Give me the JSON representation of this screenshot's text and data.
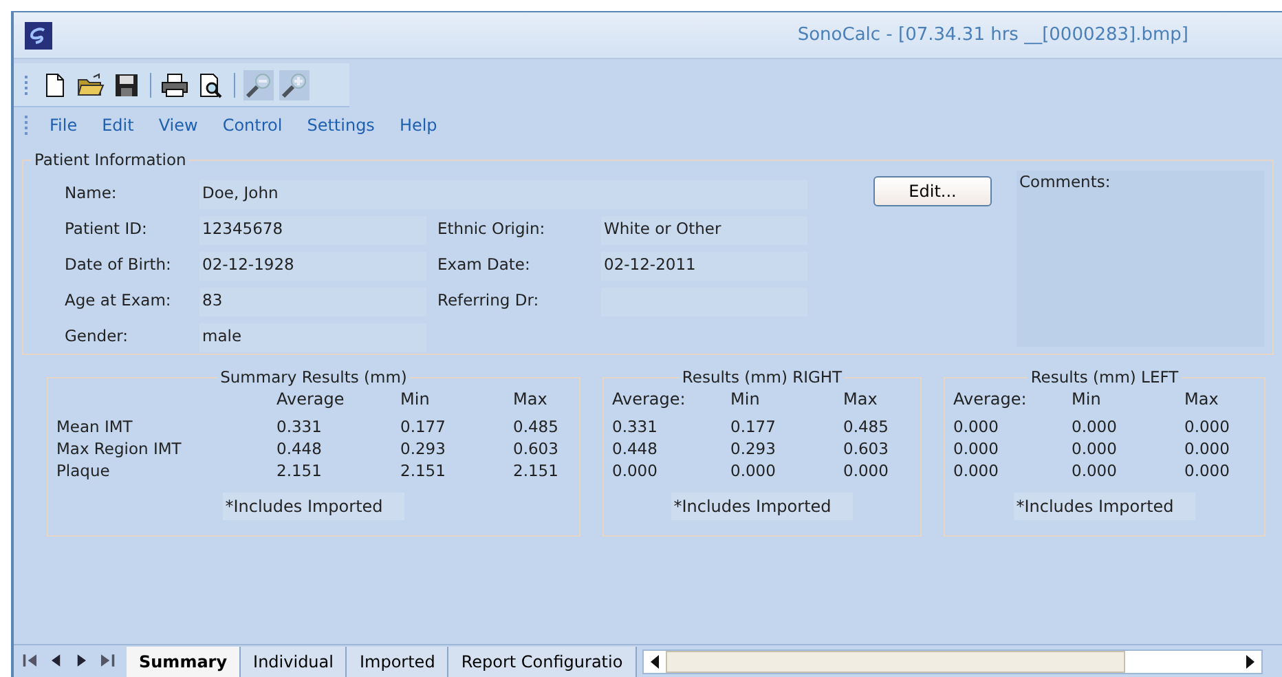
{
  "window": {
    "title": "SonoCalc - [07.34.31 hrs __[0000283].bmp]"
  },
  "toolbar": [
    {
      "kind": "new",
      "disabled": false
    },
    {
      "kind": "open",
      "disabled": false
    },
    {
      "kind": "save",
      "disabled": false
    },
    {
      "kind": "separator"
    },
    {
      "kind": "print",
      "disabled": false
    },
    {
      "kind": "preview",
      "disabled": false
    },
    {
      "kind": "separator"
    },
    {
      "kind": "zoom-out",
      "disabled": true
    },
    {
      "kind": "zoom-in",
      "disabled": true
    }
  ],
  "menu": [
    "File",
    "Edit",
    "View",
    "Control",
    "Settings",
    "Help"
  ],
  "patient": {
    "title": "Patient Information",
    "fields": [
      {
        "label": "Name:",
        "value": "Doe, John",
        "wide": true
      },
      {
        "label": "Patient ID:",
        "value": "12345678",
        "label2": "Ethnic Origin:",
        "value2": "White or Other"
      },
      {
        "label": "Date of Birth:",
        "value": "02-12-1928",
        "label2": "Exam Date:",
        "value2": "02-12-2011"
      },
      {
        "label": "Age at Exam:",
        "value": "83",
        "label2": "Referring Dr:"
      },
      {
        "label": "Gender:",
        "value": "male",
        "wide": false
      }
    ],
    "edit_button": "Edit...",
    "comments_label": "Comments:"
  },
  "results": [
    {
      "title": "Summary Results (mm)",
      "headers": [
        "Average",
        "Min",
        "Max"
      ],
      "row_labels": [
        "Mean IMT",
        "Max Region IMT",
        "Plaque"
      ],
      "rows": [
        [
          "0.331",
          "0.177",
          "0.485"
        ],
        [
          "0.448",
          "0.293",
          "0.603"
        ],
        [
          "2.151",
          "2.151",
          "2.151"
        ]
      ],
      "note": "*Includes Imported"
    },
    {
      "title": "Results (mm)  RIGHT",
      "headers": [
        "Average:",
        "Min",
        "Max"
      ],
      "rows": [
        [
          "0.331",
          "0.177",
          "0.485"
        ],
        [
          "0.448",
          "0.293",
          "0.603"
        ],
        [
          "0.000",
          "0.000",
          "0.000"
        ]
      ],
      "note": "*Includes Imported"
    },
    {
      "title": "Results (mm)  LEFT",
      "headers": [
        "Average:",
        "Min",
        "Max"
      ],
      "rows": [
        [
          "0.000",
          "0.000",
          "0.000"
        ],
        [
          "0.000",
          "0.000",
          "0.000"
        ],
        [
          "0.000",
          "0.000",
          "0.000"
        ]
      ],
      "note": "*Includes Imported"
    }
  ],
  "tabs": [
    {
      "label": "Summary",
      "selected": true
    },
    {
      "label": "Individual",
      "selected": false
    },
    {
      "label": "Imported",
      "selected": false
    },
    {
      "label": "Report Configuratio",
      "selected": false
    }
  ]
}
